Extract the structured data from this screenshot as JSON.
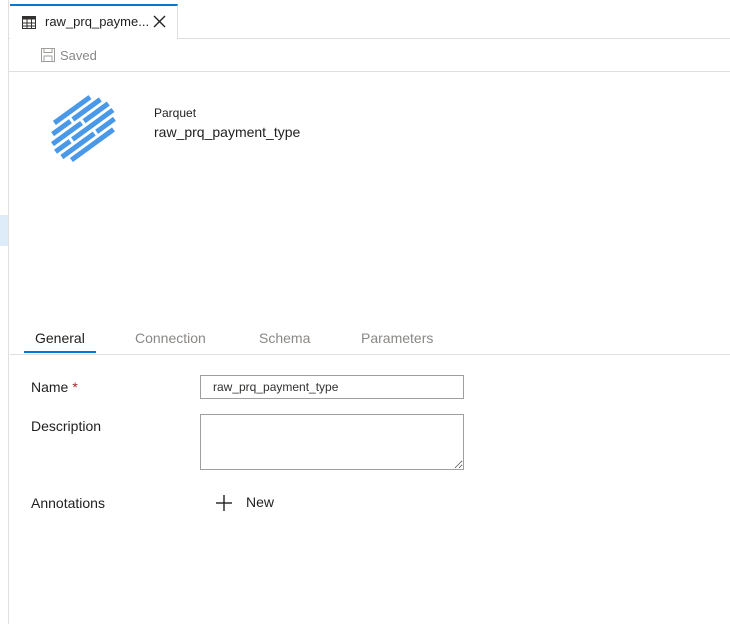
{
  "document_tab": {
    "label": "raw_prq_payme...",
    "icon": "table-icon",
    "close_icon": "close-icon"
  },
  "toolbar": {
    "save_label": "Saved",
    "save_icon": "save-icon"
  },
  "dataset": {
    "type": "Parquet",
    "name": "raw_prq_payment_type",
    "logo": "parquet-logo-icon",
    "logo_color": "#4a98e8"
  },
  "tabs": [
    {
      "label": "General",
      "active": true
    },
    {
      "label": "Connection",
      "active": false
    },
    {
      "label": "Schema",
      "active": false
    },
    {
      "label": "Parameters",
      "active": false
    }
  ],
  "form": {
    "name_label": "Name",
    "required_marker": "*",
    "name_value": "raw_prq_payment_type",
    "description_label": "Description",
    "description_value": "",
    "annotations_label": "Annotations",
    "new_label": "New"
  },
  "colors": {
    "accent": "#0078d4",
    "required": "#a4262c",
    "border": "#e1dfdd"
  }
}
